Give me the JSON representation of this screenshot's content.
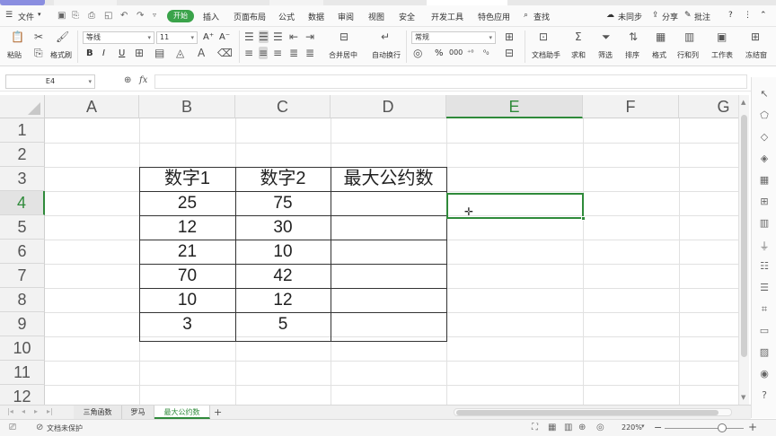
{
  "menu": {
    "file": "文件",
    "tabs": [
      "开始",
      "插入",
      "页面布局",
      "公式",
      "数据",
      "审阅",
      "视图",
      "安全",
      "开发工具",
      "特色应用"
    ],
    "search": "查找",
    "sync": "未同步",
    "share": "分享",
    "comment": "批注",
    "help": "?"
  },
  "ribbon": {
    "paste": "粘贴",
    "format_painter": "格式刷",
    "font_name": "等线",
    "font_size": "11",
    "merge_center": "合并居中",
    "wrap_text": "自动换行",
    "number_format": "常规",
    "doc_assistant": "文档助手",
    "sum": "求和",
    "filter": "筛选",
    "sort": "排序",
    "format": "格式",
    "rows_cols": "行和列",
    "worksheet": "工作表",
    "freeze": "冻结窗",
    "bold": "B",
    "italic": "I",
    "underline": "U",
    "percent": "%",
    "thousands": "000"
  },
  "formula_bar": {
    "cell_ref": "E4",
    "fx": "fx",
    "formula": ""
  },
  "grid": {
    "columns": [
      "A",
      "B",
      "C",
      "D",
      "E",
      "F",
      "G"
    ],
    "rows": [
      "1",
      "2",
      "3",
      "4",
      "5",
      "6",
      "7",
      "8",
      "9",
      "10",
      "11",
      "12"
    ],
    "selected_column": "E",
    "selected_row": "4",
    "headers": [
      "数字1",
      "数字2",
      "最大公约数"
    ],
    "table_rows": [
      {
        "b": "25",
        "c": "75",
        "d": ""
      },
      {
        "b": "12",
        "c": "30",
        "d": ""
      },
      {
        "b": "21",
        "c": "10",
        "d": ""
      },
      {
        "b": "70",
        "c": "42",
        "d": ""
      },
      {
        "b": "10",
        "c": "12",
        "d": ""
      },
      {
        "b": "3",
        "c": "5",
        "d": ""
      }
    ]
  },
  "sheets": {
    "tabs": [
      "三角函数",
      "罗马",
      "最大公约数"
    ],
    "active": "最大公约数",
    "add": "+"
  },
  "status": {
    "protection": "文档未保护",
    "zoom": "220%",
    "zoom_fraction": 0.73
  },
  "colors": {
    "accent": "#3aa34a",
    "selection": "#2f8a3a"
  }
}
